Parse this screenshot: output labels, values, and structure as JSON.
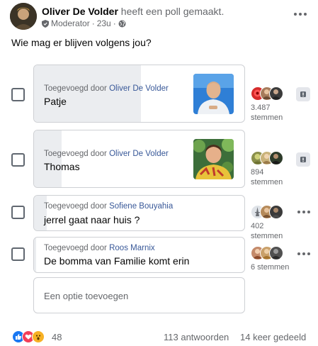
{
  "post": {
    "author": "Oliver De Volder",
    "action": "heeft een poll gemaakt.",
    "role": "Moderator",
    "time": "23u",
    "separator": "·",
    "question": "Wie mag er blijven volgens jou?"
  },
  "poll": {
    "options": [
      {
        "added_prefix": "Toegevoegd door",
        "added_by": "Oliver De Volder",
        "text": "Patje",
        "votes_number": "3.487",
        "votes_unit": "stemmen",
        "vote_share": 0.51,
        "has_photo": true
      },
      {
        "added_prefix": "Toegevoegd door",
        "added_by": "Oliver De Volder",
        "text": "Thomas",
        "votes_number": "894",
        "votes_unit": "stemmen",
        "vote_share": 0.13,
        "has_photo": true
      },
      {
        "added_prefix": "Toegevoegd door",
        "added_by": "Sofiene Bouyahia",
        "text": "jerrel gaat naar huis ?",
        "votes_number": "402",
        "votes_unit": "stemmen",
        "vote_share": 0.06,
        "has_photo": false
      },
      {
        "added_prefix": "Toegevoegd door",
        "added_by": "Roos Marnix",
        "text": "De bomma van Familie komt erin",
        "votes_text": "6 stemmen",
        "vote_share": 0.01,
        "has_photo": false
      }
    ],
    "add_option_placeholder": "Een optie toevoegen"
  },
  "footer": {
    "reaction_count": "48",
    "answers": "113 antwoorden",
    "shares": "14 keer gedeeld"
  },
  "colors": {
    "link": "#385898",
    "muted": "#65676b",
    "border": "#ced0d4",
    "fill": "#ebedf0",
    "like": "#1877f2",
    "love": "#f33e58",
    "wow": "#f7b125"
  },
  "icons": [
    "moderator-shield-icon",
    "globe-icon",
    "more-options-icon",
    "vote-action-icon",
    "like-reaction-icon",
    "love-reaction-icon",
    "wow-reaction-icon"
  ]
}
